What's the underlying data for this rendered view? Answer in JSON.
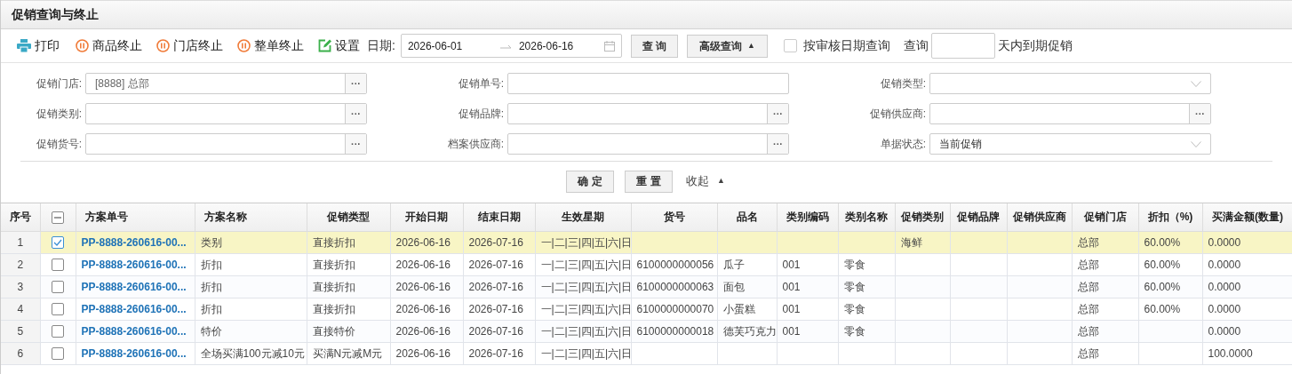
{
  "window": {
    "title": "促销查询与终止"
  },
  "toolbar": {
    "actions": [
      {
        "kind": "print",
        "label": "打印"
      },
      {
        "kind": "stop",
        "label": "商品终止"
      },
      {
        "kind": "stop",
        "label": "门店终止"
      },
      {
        "kind": "stop",
        "label": "整单终止"
      },
      {
        "kind": "settings",
        "label": "设置"
      }
    ],
    "date_label": "日期:",
    "date_from": "2026-06-01",
    "date_to": "2026-06-16",
    "query_button": "查 询",
    "advanced_button": "高级查询",
    "advanced_arrow": "▲",
    "audit_date": {
      "label": "按审核日期查询",
      "checked": false
    },
    "expire_prefix": "查询",
    "expire_suffix": "天内到期促销"
  },
  "filters": [
    {
      "label": "促销门店:",
      "kind": "picker",
      "value": "[8888] 总部",
      "button": "···"
    },
    {
      "label": "促销单号:",
      "kind": "text"
    },
    {
      "label": "促销类型:",
      "kind": "select"
    },
    {
      "label": "促销类别:",
      "kind": "picker",
      "button": "···"
    },
    {
      "label": "促销品牌:",
      "kind": "picker",
      "button": "···"
    },
    {
      "label": "促销供应商:",
      "kind": "picker",
      "button": "···"
    },
    {
      "label": "促销货号:",
      "kind": "picker",
      "button": "···"
    },
    {
      "label": "档案供应商:",
      "kind": "picker",
      "button": "···"
    },
    {
      "label": "单据状态:",
      "kind": "select",
      "value": "当前促销"
    }
  ],
  "filter_buttons": {
    "confirm": "确 定",
    "reset": "重 置",
    "collapse": "收起",
    "collapse_arrow": "▲"
  },
  "table": {
    "columns": [
      "序号",
      "",
      "方案单号",
      "方案名称",
      "促销类型",
      "开始日期",
      "结束日期",
      "生效星期",
      "货号",
      "品名",
      "类别编码",
      "类别名称",
      "促销类别",
      "促销品牌",
      "促销供应商",
      "促销门店",
      "折扣（%)",
      "买满金额(数量)"
    ],
    "header_checkbox": {
      "indeterminate": true
    },
    "rows": [
      {
        "selected": true,
        "cells": [
          "1",
          "",
          "PP-8888-260616-00...",
          "类别",
          "直接折扣",
          "2026-06-16",
          "2026-07-16",
          "一|二|三|四|五|六|日",
          "",
          "",
          "",
          "",
          "海鲜",
          "",
          "",
          "总部",
          "60.00%",
          "0.0000"
        ]
      },
      {
        "selected": false,
        "cells": [
          "2",
          "",
          "PP-8888-260616-00...",
          "折扣",
          "直接折扣",
          "2026-06-16",
          "2026-07-16",
          "一|二|三|四|五|六|日",
          "6100000000056",
          "瓜子",
          "001",
          "零食",
          "",
          "",
          "",
          "总部",
          "60.00%",
          "0.0000"
        ]
      },
      {
        "selected": false,
        "cells": [
          "3",
          "",
          "PP-8888-260616-00...",
          "折扣",
          "直接折扣",
          "2026-06-16",
          "2026-07-16",
          "一|二|三|四|五|六|日",
          "6100000000063",
          "面包",
          "001",
          "零食",
          "",
          "",
          "",
          "总部",
          "60.00%",
          "0.0000"
        ]
      },
      {
        "selected": false,
        "cells": [
          "4",
          "",
          "PP-8888-260616-00...",
          "折扣",
          "直接折扣",
          "2026-06-16",
          "2026-07-16",
          "一|二|三|四|五|六|日",
          "6100000000070",
          "小蛋糕",
          "001",
          "零食",
          "",
          "",
          "",
          "总部",
          "60.00%",
          "0.0000"
        ]
      },
      {
        "selected": false,
        "cells": [
          "5",
          "",
          "PP-8888-260616-00...",
          "特价",
          "直接特价",
          "2026-06-16",
          "2026-07-16",
          "一|二|三|四|五|六|日",
          "6100000000018",
          "德芙巧克力",
          "001",
          "零食",
          "",
          "",
          "",
          "总部",
          "",
          "0.0000"
        ]
      },
      {
        "selected": false,
        "cells": [
          "6",
          "",
          "PP-8888-260616-00...",
          "全场买满100元减10元",
          "买满N元减M元",
          "2026-06-16",
          "2026-07-16",
          "一|二|三|四|五|六|日",
          "",
          "",
          "",
          "",
          "",
          "",
          "",
          "总部",
          "",
          "100.0000"
        ]
      }
    ]
  }
}
